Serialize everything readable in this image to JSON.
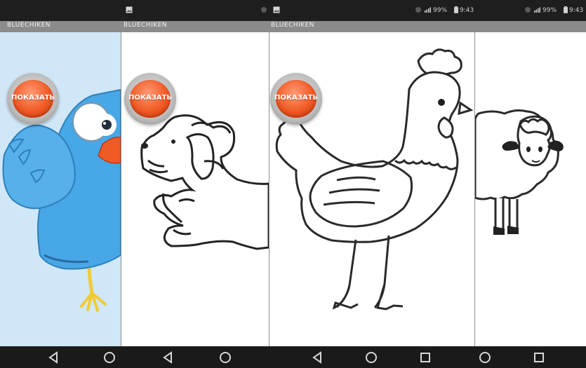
{
  "app": {
    "title_1": "BLUECHIKEN",
    "title_2": "BLUECHIKEN",
    "title_3": "BLUECHIKEN"
  },
  "buttons": {
    "show_label_1": "ПОКАЗАТЬ",
    "show_label_2": "ПОКАЗАТЬ",
    "show_label_3": "ПОКАЗАТЬ"
  },
  "status": {
    "screen_3": {
      "battery": "99%",
      "time": "9:43"
    },
    "screen_4": {
      "battery": "99%",
      "time": "9:43"
    }
  },
  "icons": {
    "status_bar": [
      "image-notification-icon",
      "sync-icon",
      "signal-icon",
      "battery-icon"
    ],
    "nav_bar": [
      "back-icon",
      "home-icon",
      "recents-icon"
    ]
  },
  "colors": {
    "button_red": "#f05a24",
    "title_bar": "#8b8b8b",
    "status_bar": "#1e1e1e",
    "nav_bar": "#1a1a1a",
    "sky": "#cfe7f7",
    "bird_blue": "#48a7e6"
  }
}
